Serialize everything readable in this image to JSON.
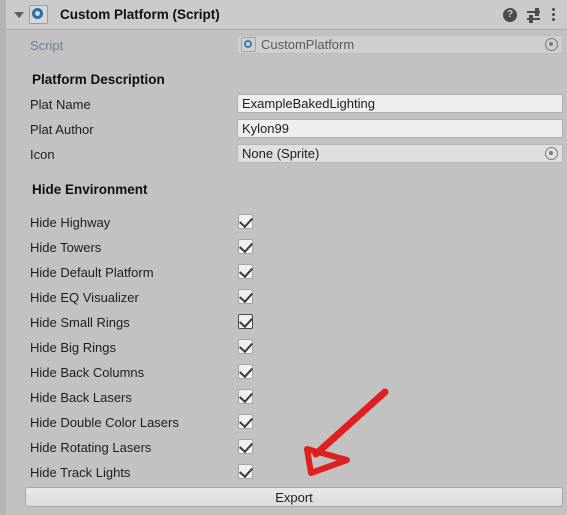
{
  "window": {
    "title": "Custom Platform (Script)",
    "foldout_expanded": true,
    "bg_color": "#c2c2c2",
    "header_bg_color": "#cbcbcb"
  },
  "header_icons": {
    "help": "?",
    "help_name": "help-icon",
    "preset_name": "preset-settings-icon",
    "menu_name": "more-menu-icon"
  },
  "script_row": {
    "label": "Script",
    "value": "CustomPlatform"
  },
  "sections": [
    {
      "title": "Platform Description"
    },
    {
      "title": "Hide Environment"
    }
  ],
  "fields": [
    {
      "label": "Plat Name",
      "value": "ExampleBakedLighting",
      "type": "text"
    },
    {
      "label": "Plat Author",
      "value": "Kylon99",
      "type": "text"
    },
    {
      "label": "Icon",
      "value": "None (Sprite)",
      "type": "object"
    }
  ],
  "toggles": [
    {
      "label": "Hide Highway",
      "checked": true,
      "focused": false
    },
    {
      "label": "Hide Towers",
      "checked": true,
      "focused": false
    },
    {
      "label": "Hide Default Platform",
      "checked": true,
      "focused": false
    },
    {
      "label": "Hide EQ Visualizer",
      "checked": true,
      "focused": false
    },
    {
      "label": "Hide Small Rings",
      "checked": true,
      "focused": true
    },
    {
      "label": "Hide Big Rings",
      "checked": true,
      "focused": false
    },
    {
      "label": "Hide Back Columns",
      "checked": true,
      "focused": false
    },
    {
      "label": "Hide Back Lasers",
      "checked": true,
      "focused": false
    },
    {
      "label": "Hide Double Color Lasers",
      "checked": true,
      "focused": false
    },
    {
      "label": "Hide Rotating Lasers",
      "checked": true,
      "focused": false
    },
    {
      "label": "Hide Track Lights",
      "checked": true,
      "focused": false
    }
  ],
  "export_button": {
    "label": "Export"
  },
  "annotation": {
    "name": "red-arrow-annotation",
    "color": "#e02020",
    "points_to": "Export"
  }
}
